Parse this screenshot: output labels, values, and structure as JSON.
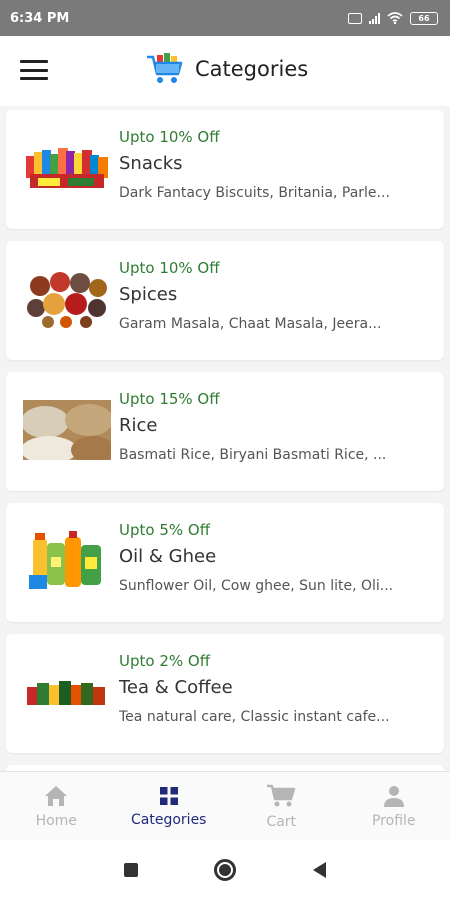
{
  "status_bar": {
    "time": "6:34 PM",
    "battery": "66"
  },
  "header": {
    "title": "Categories",
    "logo_icon": "shopping-cart-logo-icon",
    "menu_icon": "hamburger-menu-icon"
  },
  "categories": [
    {
      "discount": "Upto 10% Off",
      "name": "Snacks",
      "items": "Dark Fantacy Biscuits, Britania, Parle...",
      "image": "snacks-image"
    },
    {
      "discount": "Upto 10% Off",
      "name": "Spices",
      "items": "Garam Masala, Chaat Masala, Jeera...",
      "image": "spices-image"
    },
    {
      "discount": "Upto 15% Off",
      "name": "Rice",
      "items": "Basmati Rice, Biryani Basmati Rice, ...",
      "image": "rice-image"
    },
    {
      "discount": "Upto 5% Off",
      "name": "Oil & Ghee",
      "items": "Sunflower Oil, Cow ghee, Sun lite, Oli...",
      "image": "oil-ghee-image"
    },
    {
      "discount": "Upto 2% Off",
      "name": "Tea & Coffee",
      "items": "Tea natural care, Classic instant cafe...",
      "image": "tea-coffee-image"
    }
  ],
  "bottom_nav": [
    {
      "label": "Home",
      "icon": "home-icon",
      "active": false
    },
    {
      "label": "Categories",
      "icon": "grid-icon",
      "active": true
    },
    {
      "label": "Cart",
      "icon": "cart-icon",
      "active": false
    },
    {
      "label": "Profile",
      "icon": "person-icon",
      "active": false
    }
  ],
  "colors": {
    "accent": "#1f2a7a",
    "discount": "#2e7d32",
    "inactive": "#b5b5b5",
    "status_bar": "#7a7a7a"
  }
}
